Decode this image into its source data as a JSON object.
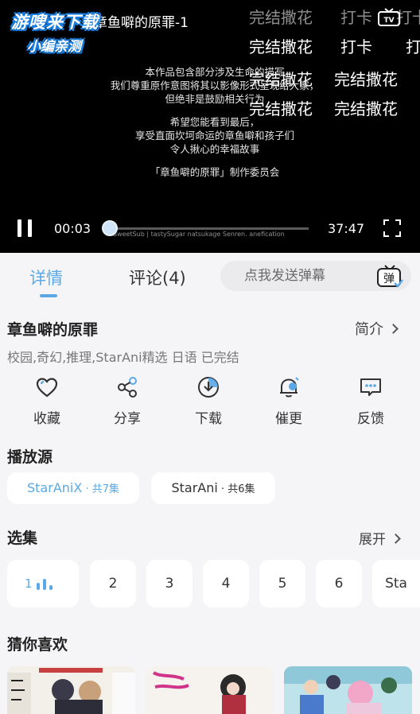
{
  "watermark": {
    "line1": "游嗖来下载",
    "line2": "小编亲测"
  },
  "player": {
    "title": "章鱼噼的原罪-1",
    "danmaku": [
      "完结撒花",
      "打卡",
      "打卡",
      "完结撒花",
      "打卡",
      "打",
      "完结撒花",
      "完结撒花",
      "完结撒花",
      "完结撒花"
    ],
    "subtitles": [
      "本作品包含部分涉及生命的描写",
      "我们尊重原作意图将其以影像形式呈现给大家，",
      "但绝非是鼓励相关行为",
      "",
      "希望您能看到最后，",
      "享受直面坎坷命运的章鱼噼和孩子们",
      "令人揪心的幸福故事",
      "",
      "「章鱼噼的原罪」制作委员会"
    ],
    "current_time": "00:03",
    "duration": "37:47",
    "progress_fraction": 0.01,
    "credit_strip": "SweetSub | tastySugar  natsukage  Senren.  anefication"
  },
  "tabs": {
    "details": "详情",
    "comments": "评论(4)"
  },
  "danmaku_input": {
    "placeholder": "点我发送弹幕",
    "button_label": "弹"
  },
  "anime": {
    "title": "章鱼噼的原罪",
    "intro_label": "简介",
    "tags": "校园,奇幻,推理,StarAni精选 日语 已完结"
  },
  "actions": [
    {
      "label": "收藏",
      "icon": "heart-icon"
    },
    {
      "label": "分享",
      "icon": "share-icon"
    },
    {
      "label": "下载",
      "icon": "download-icon"
    },
    {
      "label": "催更",
      "icon": "bell-icon"
    },
    {
      "label": "反馈",
      "icon": "feedback-icon"
    }
  ],
  "sources": {
    "title": "播放源",
    "items": [
      {
        "name": "StarAniX",
        "count": " · 共7集",
        "selected": true
      },
      {
        "name": "StarAni",
        "count": " · 共6集",
        "selected": false
      }
    ]
  },
  "episodes": {
    "title": "选集",
    "expand_label": "展开",
    "items": [
      "1",
      "2",
      "3",
      "4",
      "5",
      "6",
      "Sta"
    ],
    "playing": "1"
  },
  "recommend": {
    "title": "猜你喜欢"
  },
  "colors": {
    "accent": "#5aa9e6",
    "background": "#f5f5f7",
    "player_bg": "#000000"
  }
}
